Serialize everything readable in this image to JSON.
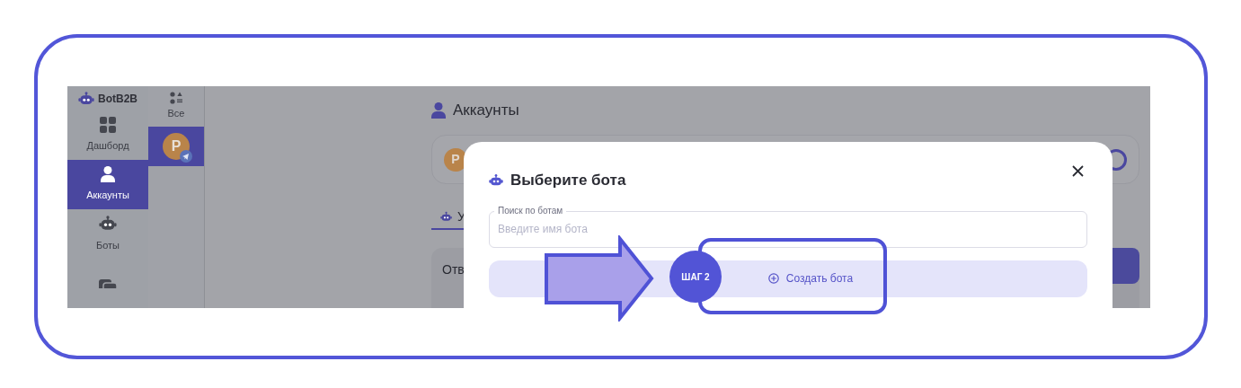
{
  "app": {
    "logo": "BotB2B",
    "nav": [
      {
        "label": "Дашборд",
        "kind": "grid",
        "selected": false
      },
      {
        "label": "Аккаунты",
        "kind": "user",
        "selected": true
      },
      {
        "label": "Боты",
        "kind": "bot",
        "selected": false
      },
      {
        "kind": "chat",
        "selected": false
      }
    ]
  },
  "filter": {
    "all_label": "Все",
    "accounts": [
      {
        "initial": "P",
        "selected": true
      }
    ]
  },
  "page": {
    "title": "Аккаунты",
    "account_initial": "P",
    "tab_label": "У",
    "panel_label": "Отв"
  },
  "modal": {
    "title": "Выберите бота",
    "search": {
      "label": "Поиск по ботам",
      "placeholder": "Введите имя бота"
    },
    "create_button": "Создать бота"
  },
  "annotation": {
    "step_label": "ШАГ 2"
  }
}
